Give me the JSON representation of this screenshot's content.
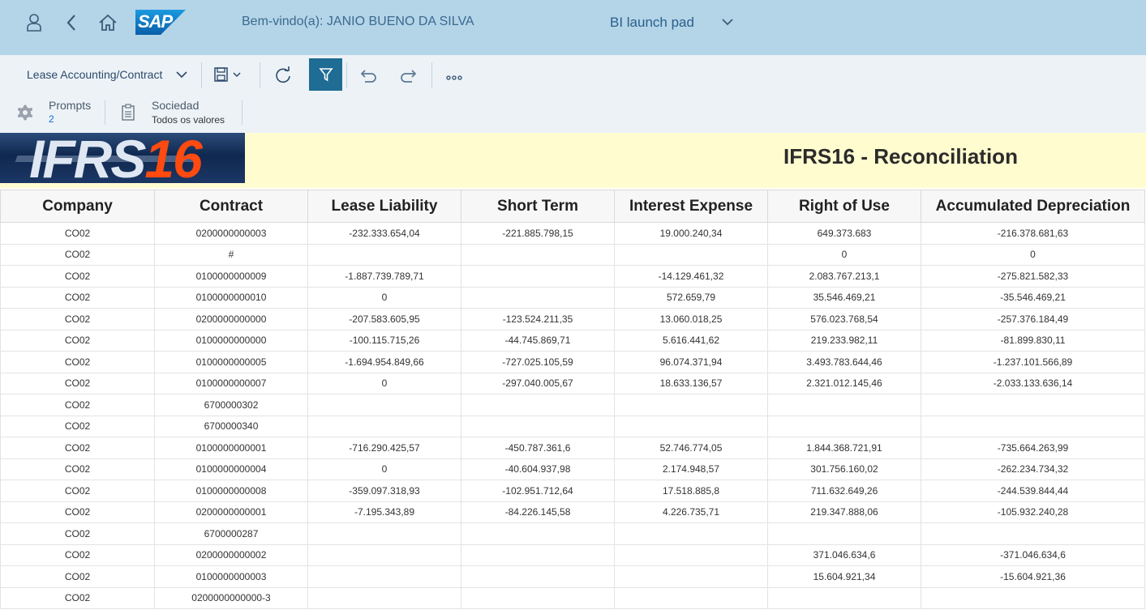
{
  "shell": {
    "welcome_text": "Bem-vindo(a): JANIO BUENO DA SILVA",
    "launchpad_label": "BI launch pad",
    "logo_text": "SAP",
    "icons": [
      "user-icon",
      "back-icon",
      "home-icon",
      "chevron-down-icon"
    ]
  },
  "toolbar": {
    "document_name": "Lease Accounting/Contract",
    "more_label": "...",
    "icons": [
      "chevron-down-icon",
      "save-icon",
      "refresh-icon",
      "filter-icon",
      "undo-icon",
      "redo-icon",
      "more-icon"
    ]
  },
  "prompts": {
    "label": "Prompts",
    "count": "2",
    "sociedad_label": "Sociedad",
    "sociedad_value": "Todos os valores"
  },
  "report": {
    "logo_text_a": "IFRS",
    "logo_text_b": "16",
    "title": "IFRS16 - Reconciliation"
  },
  "colors": {
    "shell_bg": "#b4d4e8",
    "toolbar_bg": "#edf2f7",
    "accent": "#1f6c94",
    "banner_bg": "#fffccf",
    "logo_red": "#ff4a10"
  },
  "table": {
    "headers": [
      "Company",
      "Contract",
      "Lease Liability",
      "Short Term",
      "Interest Expense",
      "Right of Use",
      "Accumulated Depreciation"
    ],
    "rows": [
      [
        "CO02",
        "0200000000003",
        "-232.333.654,04",
        "-221.885.798,15",
        "19.000.240,34",
        "649.373.683",
        "-216.378.681,63"
      ],
      [
        "CO02",
        "#",
        "",
        "",
        "",
        "0",
        "0"
      ],
      [
        "CO02",
        "0100000000009",
        "-1.887.739.789,71",
        "",
        "-14.129.461,32",
        "2.083.767.213,1",
        "-275.821.582,33"
      ],
      [
        "CO02",
        "0100000000010",
        "0",
        "",
        "572.659,79",
        "35.546.469,21",
        "-35.546.469,21"
      ],
      [
        "CO02",
        "0200000000000",
        "-207.583.605,95",
        "-123.524.211,35",
        "13.060.018,25",
        "576.023.768,54",
        "-257.376.184,49"
      ],
      [
        "CO02",
        "0100000000000",
        "-100.115.715,26",
        "-44.745.869,71",
        "5.616.441,62",
        "219.233.982,11",
        "-81.899.830,11"
      ],
      [
        "CO02",
        "0100000000005",
        "-1.694.954.849,66",
        "-727.025.105,59",
        "96.074.371,94",
        "3.493.783.644,46",
        "-1.237.101.566,89"
      ],
      [
        "CO02",
        "0100000000007",
        "0",
        "-297.040.005,67",
        "18.633.136,57",
        "2.321.012.145,46",
        "-2.033.133.636,14"
      ],
      [
        "CO02",
        "6700000302",
        "",
        "",
        "",
        "",
        ""
      ],
      [
        "CO02",
        "6700000340",
        "",
        "",
        "",
        "",
        ""
      ],
      [
        "CO02",
        "0100000000001",
        "-716.290.425,57",
        "-450.787.361,6",
        "52.746.774,05",
        "1.844.368.721,91",
        "-735.664.263,99"
      ],
      [
        "CO02",
        "0100000000004",
        "0",
        "-40.604.937,98",
        "2.174.948,57",
        "301.756.160,02",
        "-262.234.734,32"
      ],
      [
        "CO02",
        "0100000000008",
        "-359.097.318,93",
        "-102.951.712,64",
        "17.518.885,8",
        "711.632.649,26",
        "-244.539.844,44"
      ],
      [
        "CO02",
        "0200000000001",
        "-7.195.343,89",
        "-84.226.145,58",
        "4.226.735,71",
        "219.347.888,06",
        "-105.932.240,28"
      ],
      [
        "CO02",
        "6700000287",
        "",
        "",
        "",
        "",
        ""
      ],
      [
        "CO02",
        "0200000000002",
        "",
        "",
        "",
        "371.046.634,6",
        "-371.046.634,6"
      ],
      [
        "CO02",
        "0100000000003",
        "",
        "",
        "",
        "15.604.921,34",
        "-15.604.921,36"
      ],
      [
        "CO02",
        "0200000000000-3",
        "",
        "",
        "",
        "",
        ""
      ]
    ]
  }
}
